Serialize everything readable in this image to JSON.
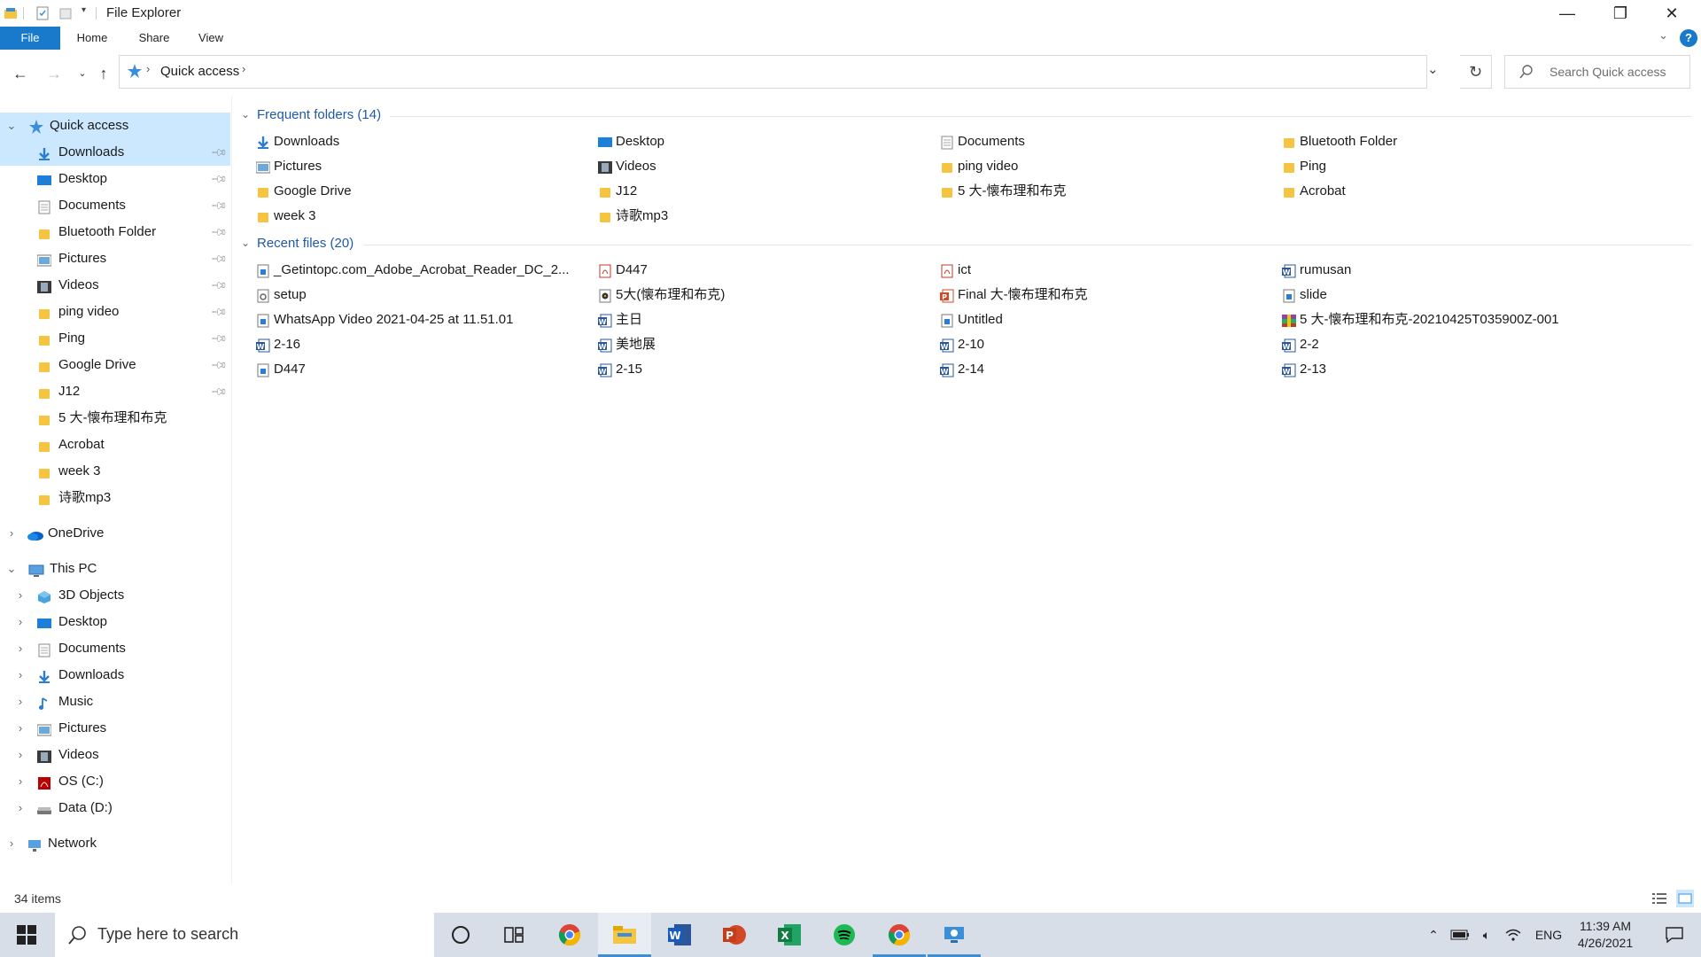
{
  "window": {
    "title": "File Explorer",
    "controls": {
      "minimize": "—",
      "maximize": "❐",
      "close": "✕"
    }
  },
  "ribbon": {
    "tabs": [
      {
        "label": "File"
      },
      {
        "label": "Home"
      },
      {
        "label": "Share"
      },
      {
        "label": "View"
      }
    ],
    "help_label": "?"
  },
  "address": {
    "crumb": "Quick access",
    "search_placeholder": "Search Quick access"
  },
  "nav": {
    "quick_access_label": "Quick access",
    "quick_access_items": [
      {
        "label": "Downloads",
        "icon": "downloads-icon",
        "pinned": true
      },
      {
        "label": "Desktop",
        "icon": "desktop-icon",
        "pinned": true
      },
      {
        "label": "Documents",
        "icon": "documents-icon",
        "pinned": true
      },
      {
        "label": "Bluetooth Folder",
        "icon": "folder-icon",
        "pinned": true
      },
      {
        "label": "Pictures",
        "icon": "pictures-icon",
        "pinned": true
      },
      {
        "label": "Videos",
        "icon": "videos-icon",
        "pinned": true
      },
      {
        "label": "ping video",
        "icon": "folder-icon",
        "pinned": true
      },
      {
        "label": "Ping",
        "icon": "folder-icon",
        "pinned": true
      },
      {
        "label": "Google Drive",
        "icon": "folder-icon",
        "pinned": true
      },
      {
        "label": "J12",
        "icon": "folder-icon",
        "pinned": true
      },
      {
        "label": "5 大-懐布理和布克",
        "icon": "folder-icon",
        "pinned": false
      },
      {
        "label": "Acrobat",
        "icon": "folder-icon",
        "pinned": false
      },
      {
        "label": "week 3",
        "icon": "folder-icon",
        "pinned": false
      },
      {
        "label": "诗歌mp3",
        "icon": "folder-icon",
        "pinned": false
      }
    ],
    "onedrive_label": "OneDrive",
    "thispc_label": "This PC",
    "thispc_items": [
      {
        "label": "3D Objects",
        "icon": "3d-objects-icon"
      },
      {
        "label": "Desktop",
        "icon": "desktop-icon"
      },
      {
        "label": "Documents",
        "icon": "documents-icon"
      },
      {
        "label": "Downloads",
        "icon": "downloads-icon"
      },
      {
        "label": "Music",
        "icon": "music-icon"
      },
      {
        "label": "Pictures",
        "icon": "pictures-icon"
      },
      {
        "label": "Videos",
        "icon": "videos-icon"
      },
      {
        "label": "OS (C:)",
        "icon": "drive-c-icon"
      },
      {
        "label": "Data (D:)",
        "icon": "drive-d-icon"
      }
    ],
    "network_label": "Network"
  },
  "frequent": {
    "header": "Frequent folders (14)",
    "items": [
      {
        "label": "Downloads",
        "icon": "downloads-icon"
      },
      {
        "label": "Desktop",
        "icon": "desktop-icon"
      },
      {
        "label": "Documents",
        "icon": "documents-icon"
      },
      {
        "label": "Bluetooth Folder",
        "icon": "folder-icon"
      },
      {
        "label": "Pictures",
        "icon": "pictures-icon"
      },
      {
        "label": "Videos",
        "icon": "videos-icon"
      },
      {
        "label": "ping video",
        "icon": "folder-icon"
      },
      {
        "label": "Ping",
        "icon": "folder-icon"
      },
      {
        "label": "Google Drive",
        "icon": "folder-icon"
      },
      {
        "label": "J12",
        "icon": "folder-icon"
      },
      {
        "label": "5 大-懐布理和布克",
        "icon": "folder-icon"
      },
      {
        "label": "Acrobat",
        "icon": "folder-icon"
      },
      {
        "label": "week 3",
        "icon": "folder-icon"
      },
      {
        "label": "诗歌mp3",
        "icon": "folder-icon"
      }
    ]
  },
  "recent": {
    "header": "Recent files (20)",
    "items": [
      {
        "label": "_Getintopc.com_Adobe_Acrobat_Reader_DC_2...",
        "icon": "document-icon"
      },
      {
        "label": "D447",
        "icon": "pdf-icon"
      },
      {
        "label": "ict",
        "icon": "pdf-icon"
      },
      {
        "label": "rumusan",
        "icon": "word-icon"
      },
      {
        "label": "setup",
        "icon": "setup-icon"
      },
      {
        "label": "5大(懐布理和布克)",
        "icon": "media-icon"
      },
      {
        "label": "Final 大-懐布理和布克",
        "icon": "powerpoint-icon"
      },
      {
        "label": "slide",
        "icon": "document-icon"
      },
      {
        "label": "WhatsApp Video 2021-04-25 at 11.51.01",
        "icon": "document-icon"
      },
      {
        "label": "主日",
        "icon": "word-icon"
      },
      {
        "label": "Untitled",
        "icon": "document-icon"
      },
      {
        "label": "5 大-懐布理和布克-20210425T035900Z-001",
        "icon": "archive-icon"
      },
      {
        "label": "2-16",
        "icon": "word-icon"
      },
      {
        "label": "美地展",
        "icon": "word-icon"
      },
      {
        "label": "2-10",
        "icon": "word-icon"
      },
      {
        "label": "2-2",
        "icon": "word-icon"
      },
      {
        "label": "D447",
        "icon": "document-icon"
      },
      {
        "label": "2-15",
        "icon": "word-icon"
      },
      {
        "label": "2-14",
        "icon": "word-icon"
      },
      {
        "label": "2-13",
        "icon": "word-icon"
      }
    ]
  },
  "status": {
    "count": "34 items"
  },
  "taskbar": {
    "search_placeholder": "Type here to search",
    "apps": [
      {
        "name": "cortana-icon",
        "active": false
      },
      {
        "name": "task-view-icon",
        "active": false
      },
      {
        "name": "chrome-icon",
        "active": false
      },
      {
        "name": "file-explorer-icon",
        "active": true
      },
      {
        "name": "word-app-icon",
        "active": false
      },
      {
        "name": "powerpoint-app-icon",
        "active": false
      },
      {
        "name": "excel-app-icon",
        "active": false
      },
      {
        "name": "spotify-icon",
        "active": false
      },
      {
        "name": "chrome-icon",
        "active": true
      },
      {
        "name": "remote-app-icon",
        "active": true
      }
    ],
    "language": "ENG",
    "time": "11:39 AM",
    "date": "4/26/2021"
  },
  "colors": {
    "accent": "#1979ca",
    "selection": "#cce8ff",
    "group_header": "#1e5aa8",
    "taskbar": "#d7dee8"
  }
}
